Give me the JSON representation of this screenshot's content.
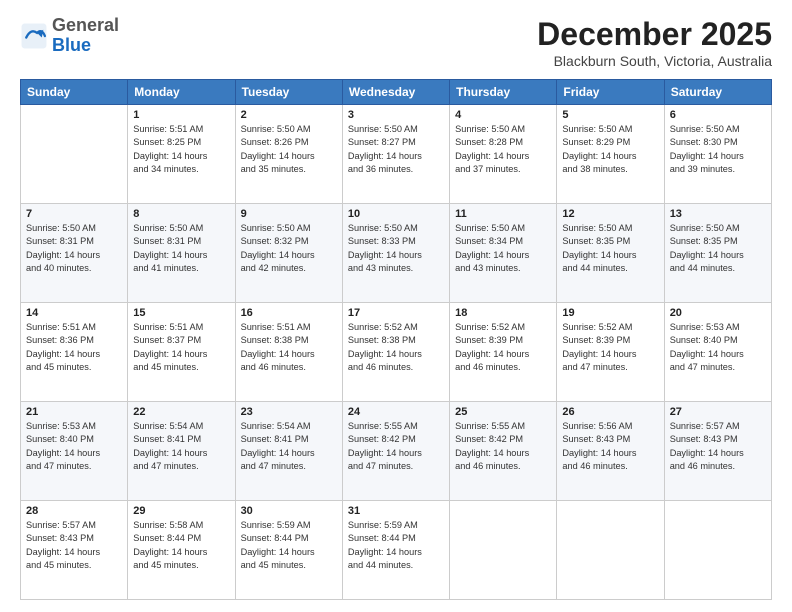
{
  "header": {
    "logo_general": "General",
    "logo_blue": "Blue",
    "month_title": "December 2025",
    "location": "Blackburn South, Victoria, Australia"
  },
  "days_of_week": [
    "Sunday",
    "Monday",
    "Tuesday",
    "Wednesday",
    "Thursday",
    "Friday",
    "Saturday"
  ],
  "weeks": [
    [
      {
        "day": "",
        "info": ""
      },
      {
        "day": "1",
        "info": "Sunrise: 5:51 AM\nSunset: 8:25 PM\nDaylight: 14 hours\nand 34 minutes."
      },
      {
        "day": "2",
        "info": "Sunrise: 5:50 AM\nSunset: 8:26 PM\nDaylight: 14 hours\nand 35 minutes."
      },
      {
        "day": "3",
        "info": "Sunrise: 5:50 AM\nSunset: 8:27 PM\nDaylight: 14 hours\nand 36 minutes."
      },
      {
        "day": "4",
        "info": "Sunrise: 5:50 AM\nSunset: 8:28 PM\nDaylight: 14 hours\nand 37 minutes."
      },
      {
        "day": "5",
        "info": "Sunrise: 5:50 AM\nSunset: 8:29 PM\nDaylight: 14 hours\nand 38 minutes."
      },
      {
        "day": "6",
        "info": "Sunrise: 5:50 AM\nSunset: 8:30 PM\nDaylight: 14 hours\nand 39 minutes."
      }
    ],
    [
      {
        "day": "7",
        "info": "Sunrise: 5:50 AM\nSunset: 8:31 PM\nDaylight: 14 hours\nand 40 minutes."
      },
      {
        "day": "8",
        "info": "Sunrise: 5:50 AM\nSunset: 8:31 PM\nDaylight: 14 hours\nand 41 minutes."
      },
      {
        "day": "9",
        "info": "Sunrise: 5:50 AM\nSunset: 8:32 PM\nDaylight: 14 hours\nand 42 minutes."
      },
      {
        "day": "10",
        "info": "Sunrise: 5:50 AM\nSunset: 8:33 PM\nDaylight: 14 hours\nand 43 minutes."
      },
      {
        "day": "11",
        "info": "Sunrise: 5:50 AM\nSunset: 8:34 PM\nDaylight: 14 hours\nand 43 minutes."
      },
      {
        "day": "12",
        "info": "Sunrise: 5:50 AM\nSunset: 8:35 PM\nDaylight: 14 hours\nand 44 minutes."
      },
      {
        "day": "13",
        "info": "Sunrise: 5:50 AM\nSunset: 8:35 PM\nDaylight: 14 hours\nand 44 minutes."
      }
    ],
    [
      {
        "day": "14",
        "info": "Sunrise: 5:51 AM\nSunset: 8:36 PM\nDaylight: 14 hours\nand 45 minutes."
      },
      {
        "day": "15",
        "info": "Sunrise: 5:51 AM\nSunset: 8:37 PM\nDaylight: 14 hours\nand 45 minutes."
      },
      {
        "day": "16",
        "info": "Sunrise: 5:51 AM\nSunset: 8:38 PM\nDaylight: 14 hours\nand 46 minutes."
      },
      {
        "day": "17",
        "info": "Sunrise: 5:52 AM\nSunset: 8:38 PM\nDaylight: 14 hours\nand 46 minutes."
      },
      {
        "day": "18",
        "info": "Sunrise: 5:52 AM\nSunset: 8:39 PM\nDaylight: 14 hours\nand 46 minutes."
      },
      {
        "day": "19",
        "info": "Sunrise: 5:52 AM\nSunset: 8:39 PM\nDaylight: 14 hours\nand 47 minutes."
      },
      {
        "day": "20",
        "info": "Sunrise: 5:53 AM\nSunset: 8:40 PM\nDaylight: 14 hours\nand 47 minutes."
      }
    ],
    [
      {
        "day": "21",
        "info": "Sunrise: 5:53 AM\nSunset: 8:40 PM\nDaylight: 14 hours\nand 47 minutes."
      },
      {
        "day": "22",
        "info": "Sunrise: 5:54 AM\nSunset: 8:41 PM\nDaylight: 14 hours\nand 47 minutes."
      },
      {
        "day": "23",
        "info": "Sunrise: 5:54 AM\nSunset: 8:41 PM\nDaylight: 14 hours\nand 47 minutes."
      },
      {
        "day": "24",
        "info": "Sunrise: 5:55 AM\nSunset: 8:42 PM\nDaylight: 14 hours\nand 47 minutes."
      },
      {
        "day": "25",
        "info": "Sunrise: 5:55 AM\nSunset: 8:42 PM\nDaylight: 14 hours\nand 46 minutes."
      },
      {
        "day": "26",
        "info": "Sunrise: 5:56 AM\nSunset: 8:43 PM\nDaylight: 14 hours\nand 46 minutes."
      },
      {
        "day": "27",
        "info": "Sunrise: 5:57 AM\nSunset: 8:43 PM\nDaylight: 14 hours\nand 46 minutes."
      }
    ],
    [
      {
        "day": "28",
        "info": "Sunrise: 5:57 AM\nSunset: 8:43 PM\nDaylight: 14 hours\nand 45 minutes."
      },
      {
        "day": "29",
        "info": "Sunrise: 5:58 AM\nSunset: 8:44 PM\nDaylight: 14 hours\nand 45 minutes."
      },
      {
        "day": "30",
        "info": "Sunrise: 5:59 AM\nSunset: 8:44 PM\nDaylight: 14 hours\nand 45 minutes."
      },
      {
        "day": "31",
        "info": "Sunrise: 5:59 AM\nSunset: 8:44 PM\nDaylight: 14 hours\nand 44 minutes."
      },
      {
        "day": "",
        "info": ""
      },
      {
        "day": "",
        "info": ""
      },
      {
        "day": "",
        "info": ""
      }
    ]
  ]
}
